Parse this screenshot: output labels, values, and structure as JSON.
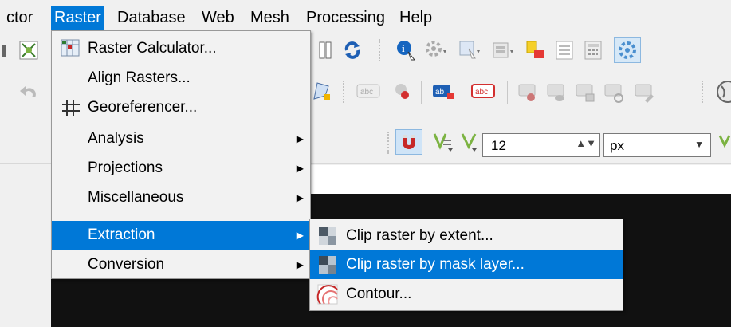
{
  "menubar": {
    "items": [
      {
        "label": "ctor"
      },
      {
        "label": "Raster"
      },
      {
        "label": "Database"
      },
      {
        "label": "Web"
      },
      {
        "label": "Mesh"
      },
      {
        "label": "Processing"
      },
      {
        "label": "Help"
      }
    ]
  },
  "raster_menu": {
    "items": [
      {
        "label": "Raster Calculator..."
      },
      {
        "label": "Align Rasters..."
      },
      {
        "label": "Georeferencer..."
      },
      {
        "label": "Analysis"
      },
      {
        "label": "Projections"
      },
      {
        "label": "Miscellaneous"
      },
      {
        "label": "Extraction"
      },
      {
        "label": "Conversion"
      }
    ]
  },
  "extraction_submenu": {
    "items": [
      {
        "label": "Clip raster by extent..."
      },
      {
        "label": "Clip raster by mask layer..."
      },
      {
        "label": "Contour..."
      }
    ]
  },
  "snapping": {
    "tolerance_value": "12",
    "units_value": "px"
  },
  "colors": {
    "accent": "#0078d7",
    "menu_bg": "#f2f2f2",
    "canvas_dark": "#111111"
  }
}
